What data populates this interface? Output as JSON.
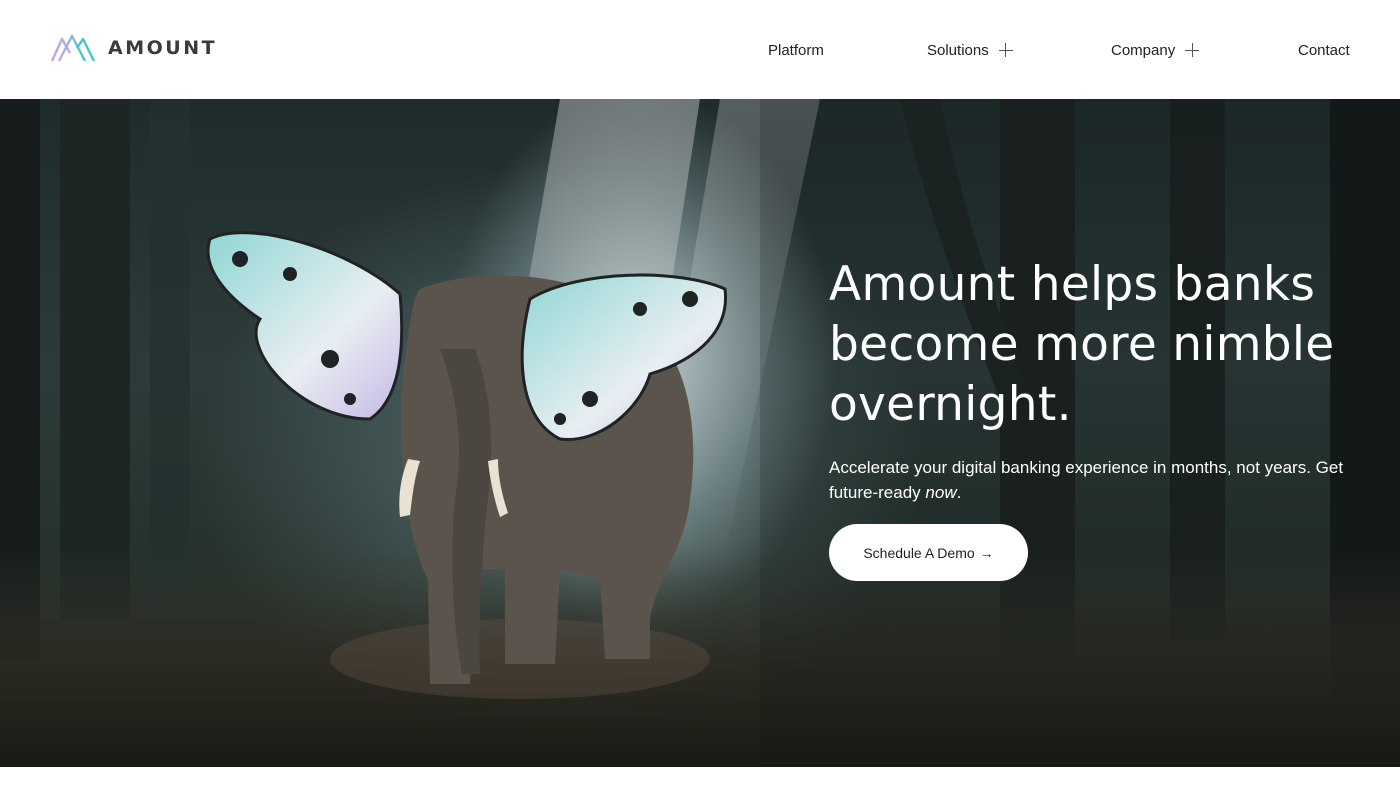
{
  "brand": {
    "name": "AMOUNT",
    "logo_icon": "mountain-logo-icon"
  },
  "nav": {
    "platform": "Platform",
    "solutions": "Solutions",
    "company": "Company",
    "contact": "Contact",
    "expand_icon": "plus-icon"
  },
  "hero": {
    "headline": "Amount helps banks become more nimble overnight.",
    "subtext_main": "Accelerate your digital banking experience in months, not years. Get future-ready",
    "subtext_emphasis": "now",
    "subtext_end": ".",
    "cta_label": "Schedule A Demo",
    "cta_arrow": "→",
    "image": "elephant-with-butterfly-wings-in-forest"
  },
  "colors": {
    "logo_teal": "#3fc6c9",
    "logo_purple": "#b39be0",
    "text_dark": "#222222"
  }
}
